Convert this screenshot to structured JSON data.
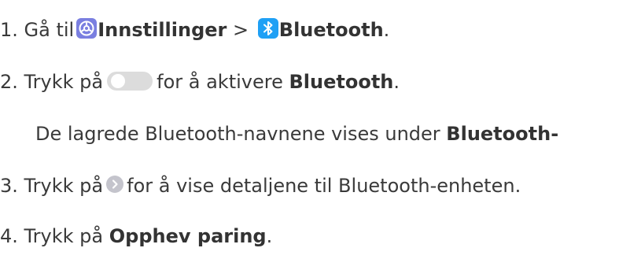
{
  "steps": [
    {
      "num": "1.",
      "pre": "Gå til",
      "settings_label": "Innstillinger",
      "sep": ">",
      "bluetooth_label": "Bluetooth",
      "end": "."
    },
    {
      "num": "2.",
      "pre": "Trykk på",
      "post": "for å aktivere",
      "bold": "Bluetooth",
      "end": "."
    },
    {
      "note_pre": "De lagrede Bluetooth-navnene vises under",
      "note_bold": "Bluetooth-"
    },
    {
      "num": "3.",
      "pre": "Trykk på",
      "post": "for å vise detaljene til Bluetooth-enheten."
    },
    {
      "num": "4.",
      "pre": "Trykk på",
      "bold": "Opphev paring",
      "end": "."
    }
  ],
  "icons": {
    "settings": "settings-gear-icon",
    "bluetooth": "bluetooth-icon",
    "toggle": "toggle-off-icon",
    "chevron": "chevron-right-circle-icon"
  },
  "colors": {
    "text": "#3a3a3a",
    "settings_icon": "#7a7fe0",
    "bluetooth_icon": "#1fa0f5",
    "toggle_track": "#dcdcdc",
    "chevron_circle": "#c4c4cc"
  }
}
